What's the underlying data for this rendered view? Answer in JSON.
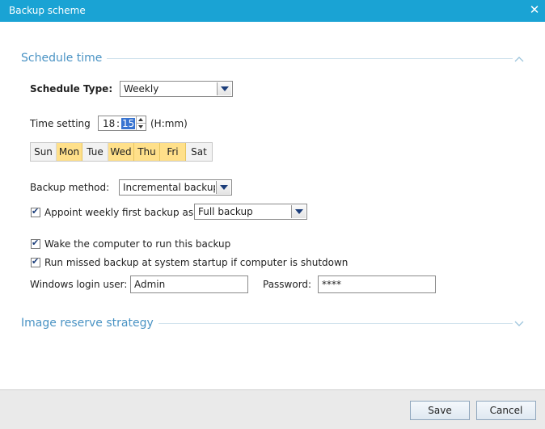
{
  "window": {
    "title": "Backup scheme",
    "close_icon": "close-icon"
  },
  "schedule": {
    "section_title": "Schedule time",
    "type_label": "Schedule Type:",
    "type_value": "Weekly",
    "time_label": "Time setting",
    "time_hour": "18",
    "time_colon": ":",
    "time_minute": "15",
    "time_format": "(H:mm)",
    "days": [
      {
        "label": "Sun",
        "selected": false
      },
      {
        "label": "Mon",
        "selected": true
      },
      {
        "label": "Tue",
        "selected": false
      },
      {
        "label": "Wed",
        "selected": true
      },
      {
        "label": "Thu",
        "selected": true
      },
      {
        "label": "Fri",
        "selected": true
      },
      {
        "label": "Sat",
        "selected": false
      }
    ],
    "method_label": "Backup method:",
    "method_value": "Incremental backup",
    "appoint_label": "Appoint weekly first backup as",
    "appoint_value": "Full backup",
    "appoint_checked": true,
    "wake_label": "Wake the computer to run this backup",
    "wake_checked": true,
    "missed_label": "Run missed backup at system startup if computer is shutdown",
    "missed_checked": true,
    "login_label": "Windows login user:",
    "login_value": "Admin",
    "password_label": "Password:",
    "password_value": "****"
  },
  "reserve": {
    "section_title": "Image reserve strategy"
  },
  "footer": {
    "save_label": "Save",
    "cancel_label": "Cancel"
  },
  "colors": {
    "titlebar": "#1aa3d4",
    "section_title": "#4a93c4",
    "day_selected": "#ffe08a"
  }
}
